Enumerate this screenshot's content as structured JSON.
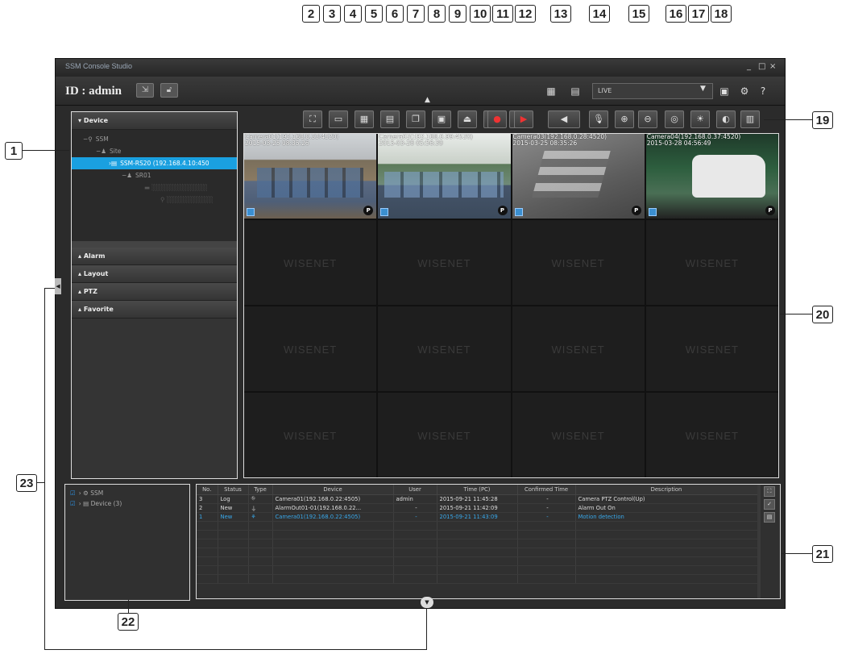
{
  "window": {
    "title": "SSM Console Studio",
    "controls": [
      "_",
      "□",
      "×"
    ]
  },
  "header": {
    "id_label": "ID : admin",
    "view_mode": "LIVE",
    "icons": [
      "layout-icon",
      "playback-layout-icon",
      "settings-icon",
      "help-icon"
    ]
  },
  "left_panel": {
    "sections": [
      {
        "label": "Device",
        "expanded": true
      },
      {
        "label": "Alarm",
        "expanded": false
      },
      {
        "label": "Layout",
        "expanded": false
      },
      {
        "label": "PTZ",
        "expanded": false
      },
      {
        "label": "Favorite",
        "expanded": false
      }
    ],
    "tree": [
      {
        "label": "SSM",
        "icon": "server-icon"
      },
      {
        "label": "Site",
        "icon": "site-icon"
      },
      {
        "label": "SSM-RS20 (192.168.4.10:450",
        "icon": "recorder-icon",
        "selected": true
      },
      {
        "label": "SR01",
        "icon": "site-icon"
      }
    ]
  },
  "toolbar": {
    "buttons": [
      {
        "name": "fullscreen-button",
        "glyph": "⛶"
      },
      {
        "name": "pip-button",
        "glyph": "▭"
      },
      {
        "name": "channel-layout-button",
        "glyph": "▦"
      },
      {
        "name": "split-layout-button",
        "glyph": "▤"
      },
      {
        "name": "overlap-button",
        "glyph": "❐"
      },
      {
        "name": "fit-screen-button",
        "glyph": "▣"
      },
      {
        "name": "alarm-button",
        "glyph": "⏏"
      },
      {
        "name": "snapshot-button",
        "glyph": "◙"
      },
      {
        "name": "print-button",
        "glyph": "⎙"
      },
      {
        "name": "record-button",
        "glyph": "●"
      },
      {
        "name": "instant-playback-button",
        "glyph": "▶"
      },
      {
        "name": "audio-button",
        "glyph": "◀"
      },
      {
        "name": "mic-button",
        "glyph": "🎙"
      },
      {
        "name": "zoom-in-button",
        "glyph": "⊕"
      },
      {
        "name": "zoom-out-button",
        "glyph": "⊖"
      },
      {
        "name": "ptz-button",
        "glyph": "◎"
      },
      {
        "name": "brightness-button",
        "glyph": "☀"
      },
      {
        "name": "contrast-button",
        "glyph": "◐"
      },
      {
        "name": "monitor-button",
        "glyph": "▥"
      }
    ]
  },
  "cameras": [
    {
      "caption1": "Camera01(192.168.0.33:4520)",
      "caption2": "2015-03-25 08:35:26"
    },
    {
      "caption1": "Camera02(192.168.0.99:4520)",
      "caption2": "2015-03-28 05:56:39"
    },
    {
      "caption1": "Camera03(192.168.0.28:4520)",
      "caption2": "2015-03-25 08:35:26"
    },
    {
      "caption1": "Camera04(192.168.0.37:4520)",
      "caption2": "2015-03-28 04:56:49"
    }
  ],
  "watermark": "WISENET",
  "bottom_left": {
    "rows": [
      {
        "label": "SSM"
      },
      {
        "label": "Device (3)"
      }
    ]
  },
  "event_log": {
    "columns": [
      "No.",
      "Status",
      "Type",
      "Device",
      "User",
      "Time (PC)",
      "Confirmed Time",
      "Description"
    ],
    "rows": [
      {
        "no": "3",
        "status": "Log",
        "type": "⛗",
        "device": "Camera01(192.168.0.22:4505)",
        "user": "admin",
        "time": "2015-09-21 11:45:28",
        "confirmed": "-",
        "desc": "Camera PTZ Control(Up)",
        "highlight": false
      },
      {
        "no": "2",
        "status": "New",
        "type": "⏚",
        "device": "AlarmOut01-01(192.168.0.22...",
        "user": "-",
        "time": "2015-09-21 11:42:09",
        "confirmed": "-",
        "desc": "Alarm Out On",
        "highlight": false
      },
      {
        "no": "1",
        "status": "New",
        "type": "⚘",
        "device": "Camera01(192.168.0.22:4505)",
        "user": "-",
        "time": "2015-09-21 11:43:09",
        "confirmed": "-",
        "desc": "Motion detection",
        "highlight": true
      }
    ]
  },
  "callouts": [
    "1",
    "2",
    "3",
    "4",
    "5",
    "6",
    "7",
    "8",
    "9",
    "10",
    "11",
    "12",
    "13",
    "14",
    "15",
    "16",
    "17",
    "18",
    "19",
    "20",
    "21",
    "22",
    "23"
  ]
}
